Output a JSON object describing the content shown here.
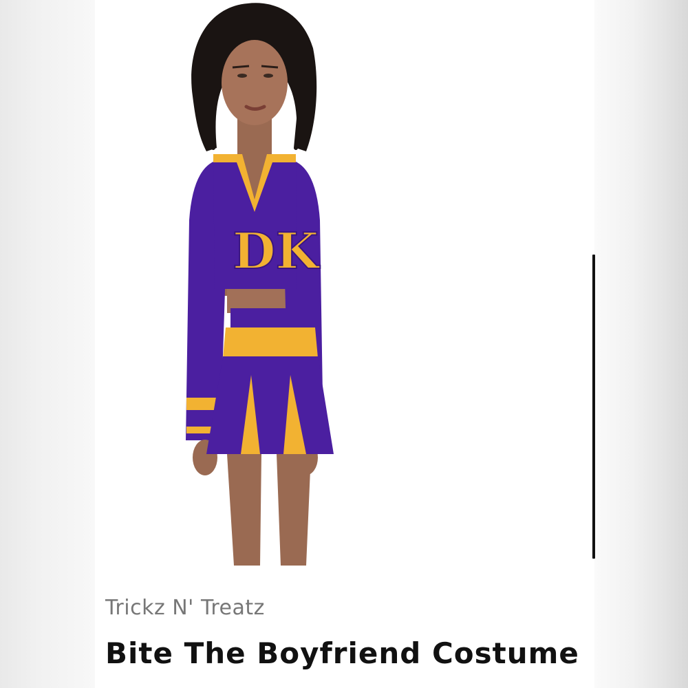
{
  "product": {
    "brand": "Trickz N' Treatz",
    "title": "Bite The Boyfriend Costume",
    "image_alt": "Model wearing purple and gold cheerleader costume",
    "print_text": "DK"
  },
  "colors": {
    "purple": "#4b1fa0",
    "gold": "#f2b232",
    "skin": "#9a6a52",
    "hair": "#1a1412"
  }
}
